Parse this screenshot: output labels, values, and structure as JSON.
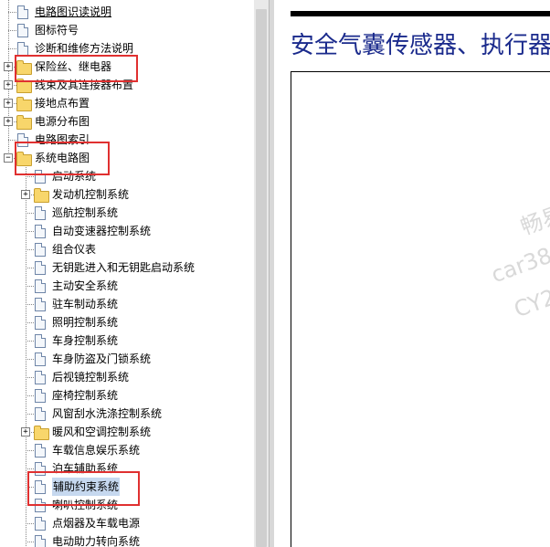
{
  "tree": {
    "items": [
      {
        "label": "电路图识读说明",
        "type": "doc",
        "level": 0,
        "underline": true
      },
      {
        "label": "图标符号",
        "type": "doc",
        "level": 0
      },
      {
        "label": "诊断和维修方法说明",
        "type": "doc",
        "level": 0
      },
      {
        "label": "保险丝、继电器",
        "type": "folder",
        "level": 0,
        "expander": "+"
      },
      {
        "label": "线束及其连接器布置",
        "type": "folder",
        "level": 0,
        "expander": "+"
      },
      {
        "label": "接地点布置",
        "type": "folder",
        "level": 0,
        "expander": "+"
      },
      {
        "label": "电源分布图",
        "type": "folder",
        "level": 0,
        "expander": "+"
      },
      {
        "label": "电路图索引",
        "type": "doc",
        "level": 0
      },
      {
        "label": "系统电路图",
        "type": "folder",
        "level": 0,
        "expander": "-"
      },
      {
        "label": "启动系统",
        "type": "doc",
        "level": 1
      },
      {
        "label": "发动机控制系统",
        "type": "folder",
        "level": 1,
        "expander": "+"
      },
      {
        "label": "巡航控制系统",
        "type": "doc",
        "level": 1
      },
      {
        "label": "自动变速器控制系统",
        "type": "doc",
        "level": 1
      },
      {
        "label": "组合仪表",
        "type": "doc",
        "level": 1
      },
      {
        "label": "无钥匙进入和无钥匙启动系统",
        "type": "doc",
        "level": 1
      },
      {
        "label": "主动安全系统",
        "type": "doc",
        "level": 1
      },
      {
        "label": "驻车制动系统",
        "type": "doc",
        "level": 1
      },
      {
        "label": "照明控制系统",
        "type": "doc",
        "level": 1
      },
      {
        "label": "车身控制系统",
        "type": "doc",
        "level": 1
      },
      {
        "label": "车身防盗及门锁系统",
        "type": "doc",
        "level": 1
      },
      {
        "label": "后视镜控制系统",
        "type": "doc",
        "level": 1
      },
      {
        "label": "座椅控制系统",
        "type": "doc",
        "level": 1
      },
      {
        "label": "风窗刮水洗涤控制系统",
        "type": "doc",
        "level": 1
      },
      {
        "label": "暖风和空调控制系统",
        "type": "folder",
        "level": 1,
        "expander": "+"
      },
      {
        "label": "车载信息娱乐系统",
        "type": "doc",
        "level": 1
      },
      {
        "label": "泊车辅助系统",
        "type": "doc",
        "level": 1
      },
      {
        "label": "辅助约束系统",
        "type": "doc",
        "level": 1,
        "selected": true
      },
      {
        "label": "喇叭控制系统",
        "type": "doc",
        "level": 1
      },
      {
        "label": "点烟器及车载电源",
        "type": "doc",
        "level": 1
      },
      {
        "label": "电动助力转向系统",
        "type": "doc",
        "level": 1
      }
    ]
  },
  "content": {
    "title": "安全气囊传感器、执行器",
    "watermarks": [
      "畅易",
      "car38",
      "CY2"
    ]
  },
  "colors": {
    "title": "#1a2a8c",
    "highlight_box": "#e03030",
    "selection": "#c6d8ef"
  }
}
